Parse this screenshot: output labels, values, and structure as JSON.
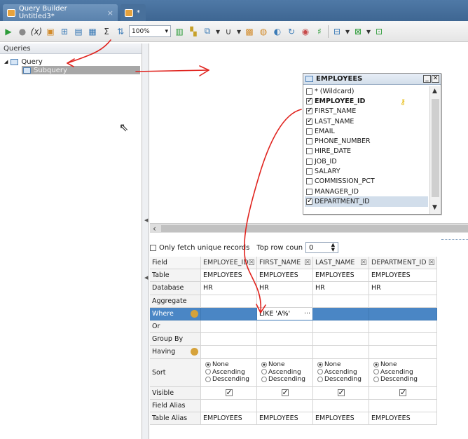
{
  "tabs": {
    "main_title": "Query Builder Untitled3*",
    "close": "×",
    "new_tab": "*"
  },
  "toolbar": {
    "zoom": "100%",
    "sigma": "Σ"
  },
  "left_panel": {
    "header": "Queries",
    "tree": {
      "query": "Query",
      "subquery": "Subquery"
    }
  },
  "table_window": {
    "title": "EMPLOYEES",
    "fields": [
      {
        "label": "* (Wildcard)",
        "checked": false
      },
      {
        "label": "EMPLOYEE_ID",
        "checked": true
      },
      {
        "label": "FIRST_NAME",
        "checked": true
      },
      {
        "label": "LAST_NAME",
        "checked": true
      },
      {
        "label": "EMAIL",
        "checked": false
      },
      {
        "label": "PHONE_NUMBER",
        "checked": false
      },
      {
        "label": "HIRE_DATE",
        "checked": false
      },
      {
        "label": "JOB_ID",
        "checked": false
      },
      {
        "label": "SALARY",
        "checked": false
      },
      {
        "label": "COMMISSION_PCT",
        "checked": false
      },
      {
        "label": "MANAGER_ID",
        "checked": false
      },
      {
        "label": "DEPARTMENT_ID",
        "checked": true
      }
    ]
  },
  "options": {
    "unique_label": "Only fetch unique records",
    "top_label": "Top row coun",
    "top_value": "0"
  },
  "grid": {
    "row_labels": [
      "Field",
      "Table",
      "Database",
      "Aggregate",
      "Where",
      "Or",
      "Group By",
      "Having",
      "Sort",
      "Visible",
      "Field Alias",
      "Table Alias"
    ],
    "columns": [
      {
        "field": "EMPLOYEE_ID",
        "table": "EMPLOYEES",
        "database": "HR",
        "where": "",
        "table_alias": "EMPLOYEES"
      },
      {
        "field": "FIRST_NAME",
        "table": "EMPLOYEES",
        "database": "HR",
        "where": "LIKE 'A%'",
        "table_alias": "EMPLOYEES"
      },
      {
        "field": "LAST_NAME",
        "table": "EMPLOYEES",
        "database": "HR",
        "where": "",
        "table_alias": "EMPLOYEES"
      },
      {
        "field": "DEPARTMENT_ID",
        "table": "EMPLOYEES",
        "database": "HR",
        "where": "",
        "table_alias": "EMPLOYEES"
      }
    ],
    "sort_options": [
      "None",
      "Ascending",
      "Descending"
    ],
    "ellipsis": "···"
  }
}
